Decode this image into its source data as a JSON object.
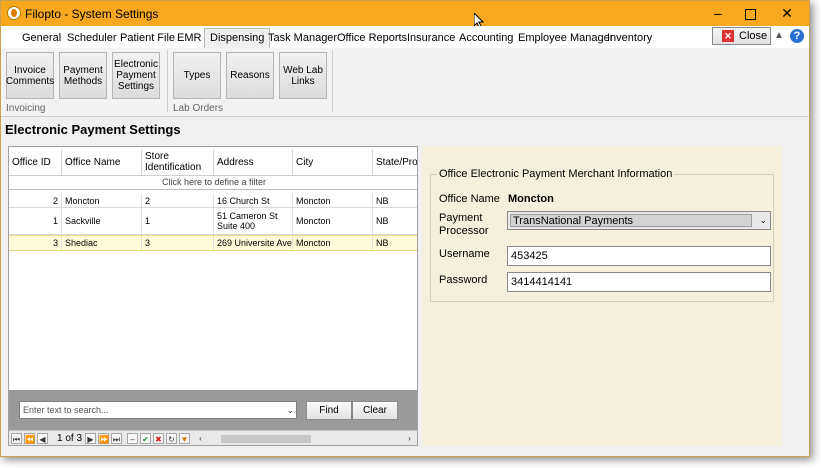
{
  "window": {
    "title": "Filopto - System Settings"
  },
  "menu": {
    "tabs": [
      "General",
      "Scheduler",
      "Patient File",
      "EMR",
      "Dispensing",
      "Task Manager",
      "Office Reports",
      "Insurance",
      "Accounting",
      "Employee Manager",
      "Inventory"
    ],
    "active_tab": "Dispensing",
    "close_label": "Close"
  },
  "ribbon": {
    "invoicing_buttons": [
      "Invoice Comments",
      "Payment Methods",
      "Electronic Payment Settings"
    ],
    "invoicing_label": "Invoicing",
    "lab_buttons": [
      "Types",
      "Reasons",
      "Web Lab Links"
    ],
    "lab_label": "Lab Orders"
  },
  "heading": "Electronic Payment Settings",
  "grid": {
    "columns": [
      "Office ID",
      "Office Name",
      "Store Identification",
      "Address",
      "City",
      "State/Provi"
    ],
    "filter_hint": "Click here to define a filter",
    "rows": [
      {
        "office_id": "2",
        "office_name": "Moncton",
        "store": "2",
        "address": "16 Church St",
        "city": "Moncton",
        "state": "NB"
      },
      {
        "office_id": "1",
        "office_name": "Sackville",
        "store": "1",
        "address": "51 Cameron St Suite 400",
        "city": "Moncton",
        "state": "NB"
      },
      {
        "office_id": "3",
        "office_name": "Shediac",
        "store": "3",
        "address": "269 Universite Ave",
        "city": "Moncton",
        "state": "NB"
      }
    ],
    "selected_row": 2,
    "search_placeholder": "Enter text to search...",
    "find_label": "Find",
    "clear_label": "Clear",
    "page_label": "1 of 3"
  },
  "merchant": {
    "legend": "Office Electronic Payment Merchant Information",
    "office_name_label": "Office Name",
    "office_name_value": "Moncton",
    "processor_label": "Payment Processor",
    "processor_value": "TransNational Payments",
    "username_label": "Username",
    "username_value": "453425",
    "password_label": "Password",
    "password_value": "3414414141"
  },
  "colors": {
    "titlebar": "#f8a81f",
    "selected_row": "#fffbd9",
    "detail_panel": "#f4f0dd"
  }
}
